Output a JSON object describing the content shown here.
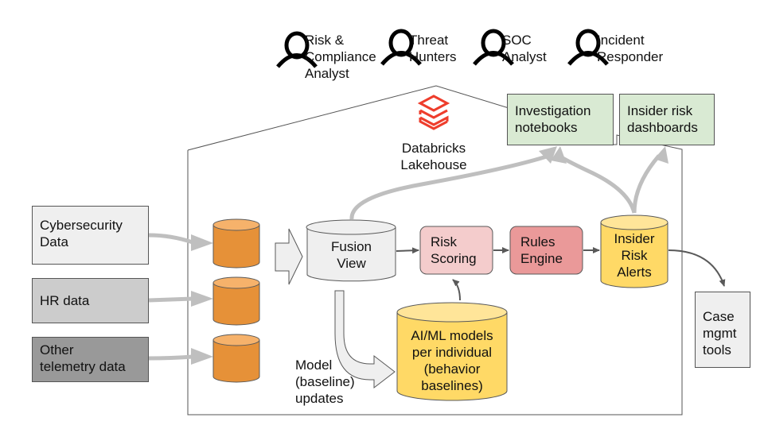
{
  "personas": [
    {
      "label": "Risk &\nCompliance\nAnalyst",
      "icon": "person-icon"
    },
    {
      "label": "Threat\nHunters",
      "icon": "person-icon"
    },
    {
      "label": "SOC\nAnalyst",
      "icon": "person-icon"
    },
    {
      "label": "Incident\nResponder",
      "icon": "person-icon"
    }
  ],
  "platform": {
    "name": "Databricks\nLakehouse",
    "icon": "databricks-logo-icon",
    "brand_color": "#ee3d2c"
  },
  "sources": [
    {
      "label": "Cybersecurity\nData",
      "color": "#efefef"
    },
    {
      "label": "HR data",
      "color": "#cccccc"
    },
    {
      "label": "Other\ntelemetry data",
      "color": "#999999"
    }
  ],
  "ingest_store_color": "#e69138",
  "pipeline": {
    "fusion_view": {
      "label": "Fusion\nView",
      "color": "#efefef"
    },
    "risk_scoring": {
      "label": "Risk\nScoring",
      "color": "#f4cccc"
    },
    "rules_engine": {
      "label": "Rules\nEngine",
      "color": "#ea9999"
    },
    "alerts": {
      "label": "Insider\nRisk\nAlerts",
      "color": "#ffd966"
    },
    "models": {
      "label": "AI/ML models\nper individual\n(behavior\nbaselines)",
      "color": "#ffd966"
    },
    "model_updates_label": "Model\n(baseline)\nupdates"
  },
  "outputs": [
    {
      "label": "Investigation\nnotebooks",
      "color": "#d9ead3"
    },
    {
      "label": "Insider risk\ndashboards",
      "color": "#d9ead3"
    }
  ],
  "external": {
    "label": "Case\nmgmt\ntools",
    "color": "#efefef"
  }
}
